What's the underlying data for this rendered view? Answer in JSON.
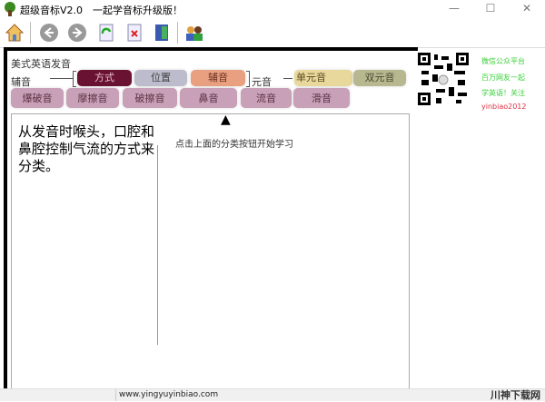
{
  "window": {
    "title": "超级音标V2.0　一起学音标升级版！",
    "minimize": "—",
    "maximize": "☐",
    "close": "✕"
  },
  "toolbar": {
    "icons": [
      "home-icon",
      "back-icon",
      "forward-icon",
      "refresh-icon",
      "close-doc-icon",
      "exit-icon",
      "users-icon"
    ]
  },
  "main": {
    "heading": "美式英语发音",
    "consonant_label": "辅音",
    "vowel_label": "元音",
    "row1": [
      {
        "label": "方式",
        "color": "#6a1232",
        "text": "#e8c0d0"
      },
      {
        "label": "位置",
        "color": "#bcbccc",
        "text": "#444"
      },
      {
        "label": "辅音",
        "color": "#e8a080",
        "text": "#6a3020"
      },
      {
        "label": "单元音",
        "color": "#e8d89c",
        "text": "#5a4a20"
      },
      {
        "label": "双元音",
        "color": "#b8b890",
        "text": "#4a4a30"
      }
    ],
    "row2": [
      "爆破音",
      "摩擦音",
      "破擦音",
      "鼻音",
      "流音",
      "滑音"
    ],
    "description": "从发音时喉头，口腔和鼻腔控制气流的方式来分类。",
    "instruction": "点击上面的分类按钮开始学习",
    "pointer": "▲"
  },
  "side": {
    "lines": [
      "微信公众平台",
      "百万网友一起",
      "学英语！关注",
      "yinbiao2012"
    ],
    "colors": {
      "green": "#38d038",
      "red": "#e03040"
    }
  },
  "status": {
    "url": "www.yingyuyinbiao.com",
    "watermark": "川神下载网"
  }
}
